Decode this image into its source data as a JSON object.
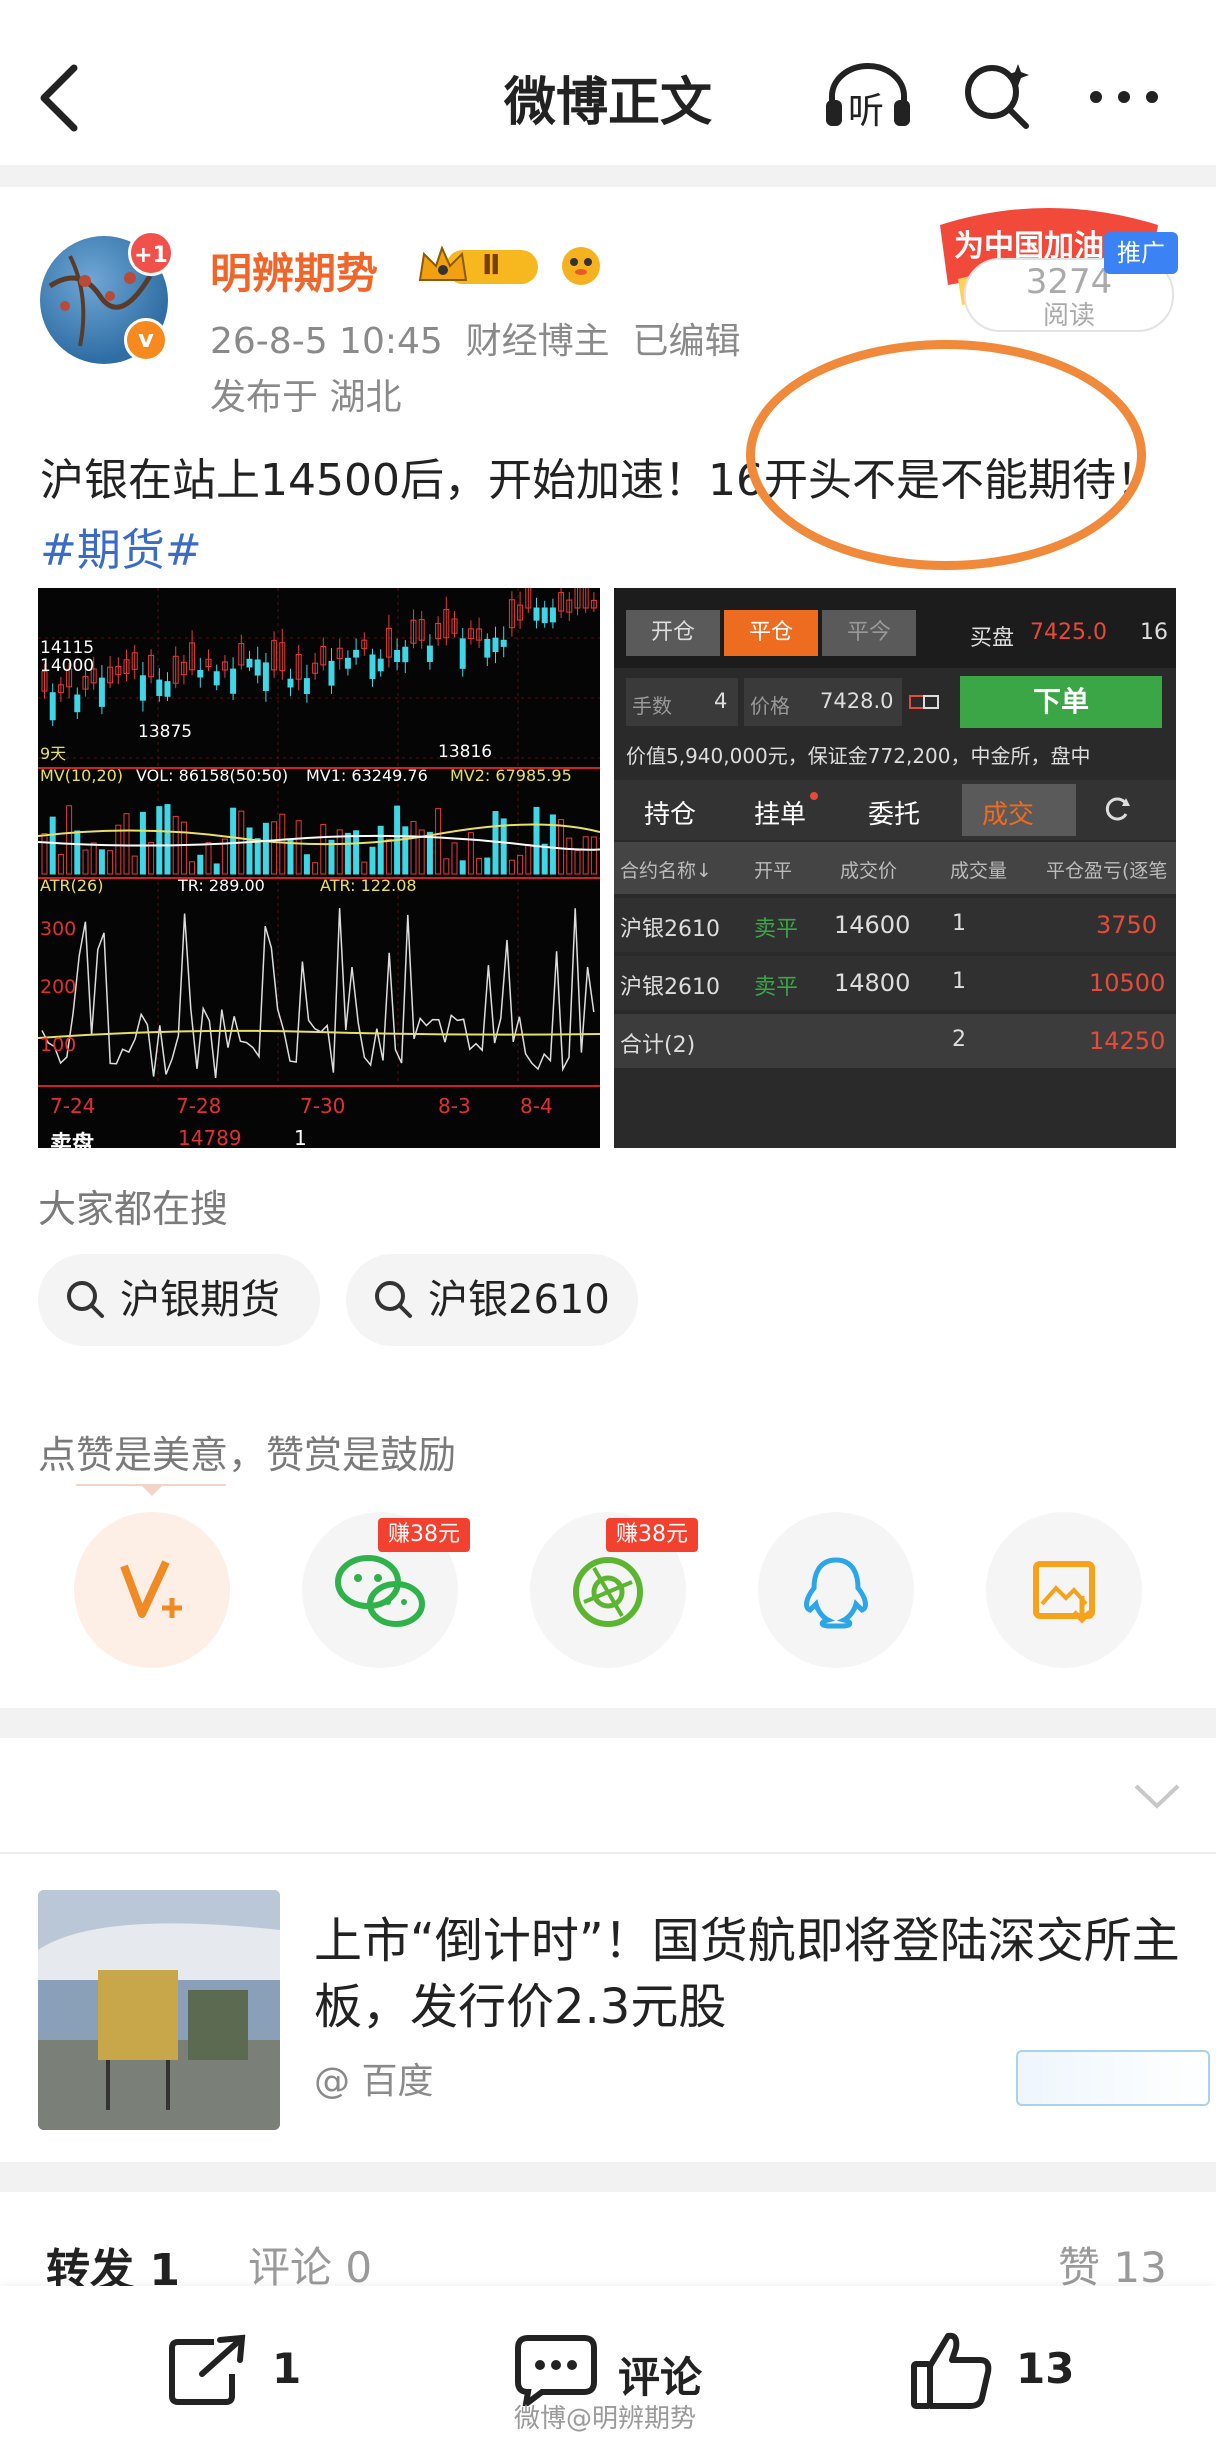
{
  "header": {
    "title": "微博正文",
    "listen_label": "听"
  },
  "post": {
    "avatar_badge": "+1",
    "username": "明辨期势",
    "level": "Ⅱ",
    "meta_line": "26-8-5 10:45  财经博主  已编辑",
    "location": "发布于 湖北",
    "promo_banner": "为中国加油",
    "promo_tag": "推广",
    "read_count": "3274",
    "read_label": "阅读",
    "text_main": "沪银在站上14500后，开始加速！16开头不是不能期待！",
    "hashtag": "#期货#"
  },
  "chart_image": {
    "price_labels": [
      "14115",
      "14000",
      "13875",
      "13816"
    ],
    "days_label": "9天",
    "mv_line": {
      "mv": "MV(10,20)",
      "vol": "VOL: 86158(50:50)",
      "mv1": "MV1: 63249.76",
      "mv2": "MV2: 67985.95"
    },
    "atr_line": {
      "atr": "ATR(26)",
      "tr": "TR: 289.00",
      "atr_val": "ATR: 122.08"
    },
    "atr_ticks": [
      "300",
      "200",
      "100"
    ],
    "dates": [
      "7-24",
      "7-28",
      "7-30",
      "8-3",
      "8-4"
    ],
    "bottom_label": "卖盘",
    "bottom_value": "14789",
    "bottom_qty": "1"
  },
  "trade_image": {
    "buttons": [
      "开仓",
      "平仓",
      "平今"
    ],
    "buy_label": "买盘",
    "buy_price": "7425.0",
    "buy_qty": "16",
    "qty_label": "手数",
    "qty_value": "4",
    "price_label": "价格",
    "price_value": "7428.0",
    "order_button": "下单",
    "info": "价值5,940,000元，保证金772,200，中金所，盘中",
    "tabs": [
      "持仓",
      "挂单",
      "委托",
      "成交"
    ],
    "headers": [
      "合约名称↓",
      "开平",
      "成交价",
      "成交量",
      "平仓盈亏(逐笔"
    ],
    "rows": [
      [
        "沪银2610",
        "卖平",
        "14600",
        "1",
        "3750"
      ],
      [
        "沪银2610",
        "卖平",
        "14800",
        "1",
        "10500"
      ]
    ],
    "total": [
      "合计(2)",
      "",
      "",
      "2",
      "14250"
    ]
  },
  "search": {
    "title": "大家都在搜",
    "items": [
      "沪银期货",
      "沪银2610"
    ]
  },
  "reward": {
    "title": "点赞是美意，赞赏是鼓励",
    "earn_badge_1": "赚38元",
    "earn_badge_2": "赚38元"
  },
  "ad": {
    "title": "上市“倒计时”！国货航即将登陆深交所主板，发行价2.3元股",
    "source": "@ 百度"
  },
  "tabs": {
    "repost_label": "转发",
    "repost_count": "1",
    "comment_label": "评论",
    "comment_count": "0",
    "like_label": "赞",
    "like_count": "13"
  },
  "bottom_bar": {
    "share_count": "1",
    "comment_label": "评论",
    "like_count": "13"
  },
  "watermark": "微博@明辨期势",
  "colors": {
    "accent": "#f0662a",
    "link": "#3a6cc7",
    "green": "#3aa646",
    "red": "#e84a3a"
  }
}
